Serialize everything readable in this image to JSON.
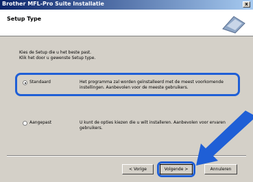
{
  "window": {
    "title": "Brother MFL-Pro Suite Installatie",
    "close_glyph": "x"
  },
  "header": {
    "title": "Setup Type"
  },
  "body": {
    "line1": "Kies de Setup die u het beste past.",
    "line2": "Klik het door u gewenste Setup type."
  },
  "options": [
    {
      "label": "Standaard",
      "selected": true,
      "description": "Het programma zal worden geïnstalleerd met de meest voorkomende instellingen. Aanbevolen voor de meeste gebruikers."
    },
    {
      "label": "Aangepast",
      "selected": false,
      "description": "U kunt de opties kiezen die u wilt installeren. Aanbevolen voor ervaren gebruikers."
    }
  ],
  "buttons": {
    "back": "< Vorige",
    "next": "Volgende >",
    "cancel": "Annuleren"
  },
  "colors": {
    "highlight": "#1f5fd6",
    "titlebar_start": "#0a246a",
    "titlebar_end": "#a6caf0",
    "face": "#d4d0c8"
  }
}
